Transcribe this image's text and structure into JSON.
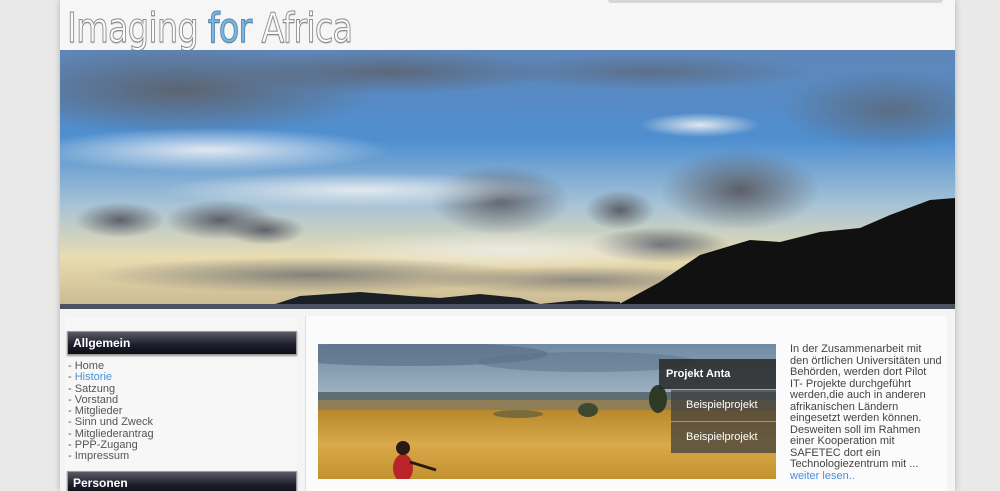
{
  "header": {
    "logo_part1": "Imaging ",
    "logo_accent": "for",
    "logo_part3": " Africa"
  },
  "sidebar": {
    "heading_allgemein": "Allgemein",
    "items": [
      {
        "label": "Home"
      },
      {
        "label": "Historie"
      },
      {
        "label": "Satzung"
      },
      {
        "label": "Vorstand"
      },
      {
        "label": "Mitglieder"
      },
      {
        "label": "Sinn und Zweck"
      },
      {
        "label": "Mitgliederantrag"
      },
      {
        "label": "PPP-Zugang"
      },
      {
        "label": "Impressum"
      }
    ],
    "bullet": "- ",
    "heading_personen": "Personen"
  },
  "feature": {
    "tabs": [
      {
        "label": "Projekt Anta"
      },
      {
        "label": "Beispielprojekt"
      },
      {
        "label": "Beispielprojekt"
      }
    ],
    "description": "In der Zusammenarbeit mit den örtlichen Universitäten und Behörden, werden dort Pilot IT- Projekte durchgeführt werden,die auch in anderen afrikanischen Ländern eingesetzt werden können. Desweiten soll im Rahmen einer Kooperation mit SAFETEC  dort ein Technologiezentrum mit ...",
    "more_link": "weiter lesen.."
  },
  "colors": {
    "accent_blue": "#4a90d9",
    "logo_blue": "#7db6dc",
    "menu_head_dark": "#1c1c2a"
  }
}
